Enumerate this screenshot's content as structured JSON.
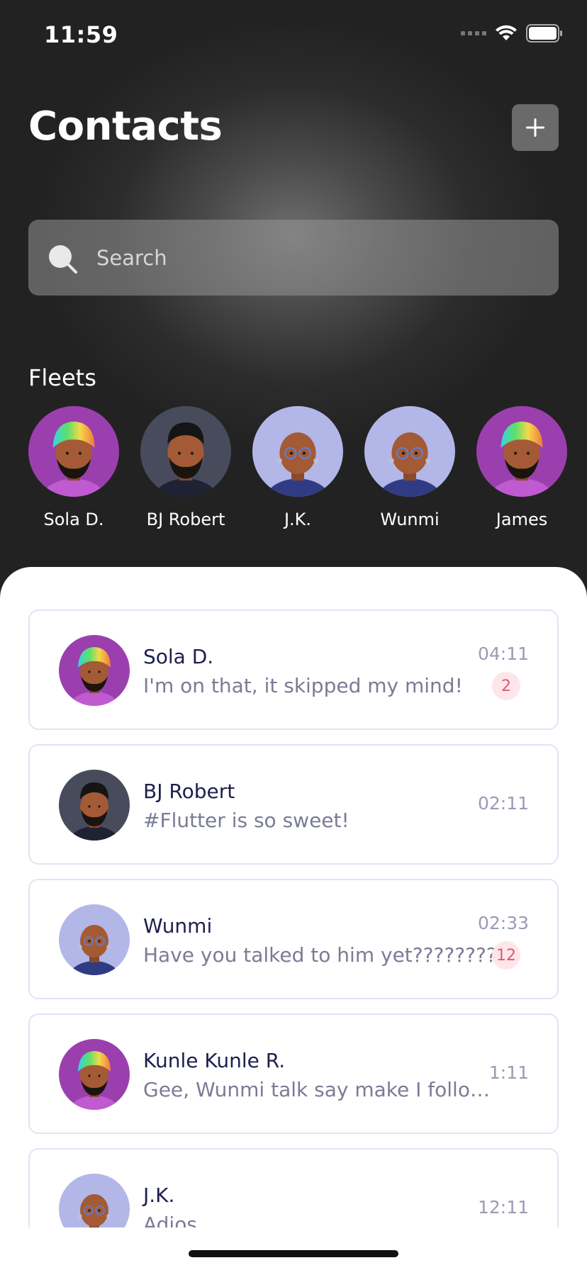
{
  "status_bar": {
    "time": "11:59"
  },
  "header": {
    "title": "Contacts",
    "add_icon": "plus-icon"
  },
  "search": {
    "placeholder": "Search",
    "icon": "search-icon"
  },
  "fleets": {
    "title": "Fleets",
    "items": [
      {
        "name": "Sola D.",
        "avatar": "turban"
      },
      {
        "name": "BJ Robert",
        "avatar": "dark"
      },
      {
        "name": "J.K.",
        "avatar": "glasses"
      },
      {
        "name": "Wunmi",
        "avatar": "glasses"
      },
      {
        "name": "James",
        "avatar": "turban"
      }
    ]
  },
  "chats": [
    {
      "name": "Sola D.",
      "message": "I'm on that, it skipped my mind!",
      "time": "04:11",
      "badge": "2",
      "avatar": "turban"
    },
    {
      "name": "BJ Robert",
      "message": "#Flutter is so sweet!",
      "time": "02:11",
      "badge": "",
      "avatar": "dark"
    },
    {
      "name": "Wunmi",
      "message": "Have you talked to him yet????????",
      "time": "02:33",
      "badge": "12",
      "avatar": "glasses"
    },
    {
      "name": "Kunle Kunle R.",
      "message": "Gee, Wunmi talk say make I follow you come",
      "time": "1:11",
      "badge": "",
      "avatar": "turban"
    },
    {
      "name": "J.K.",
      "message": "Adios",
      "time": "12:11",
      "badge": "",
      "avatar": "glasses"
    }
  ],
  "colors": {
    "badge_bg": "#fde6ea",
    "badge_text": "#e05a6f",
    "name_text": "#1d1f4d",
    "turban_bg": "#9b3fae",
    "dark_bg": "#474b5c",
    "glasses_bg": "#b3b7e8"
  }
}
